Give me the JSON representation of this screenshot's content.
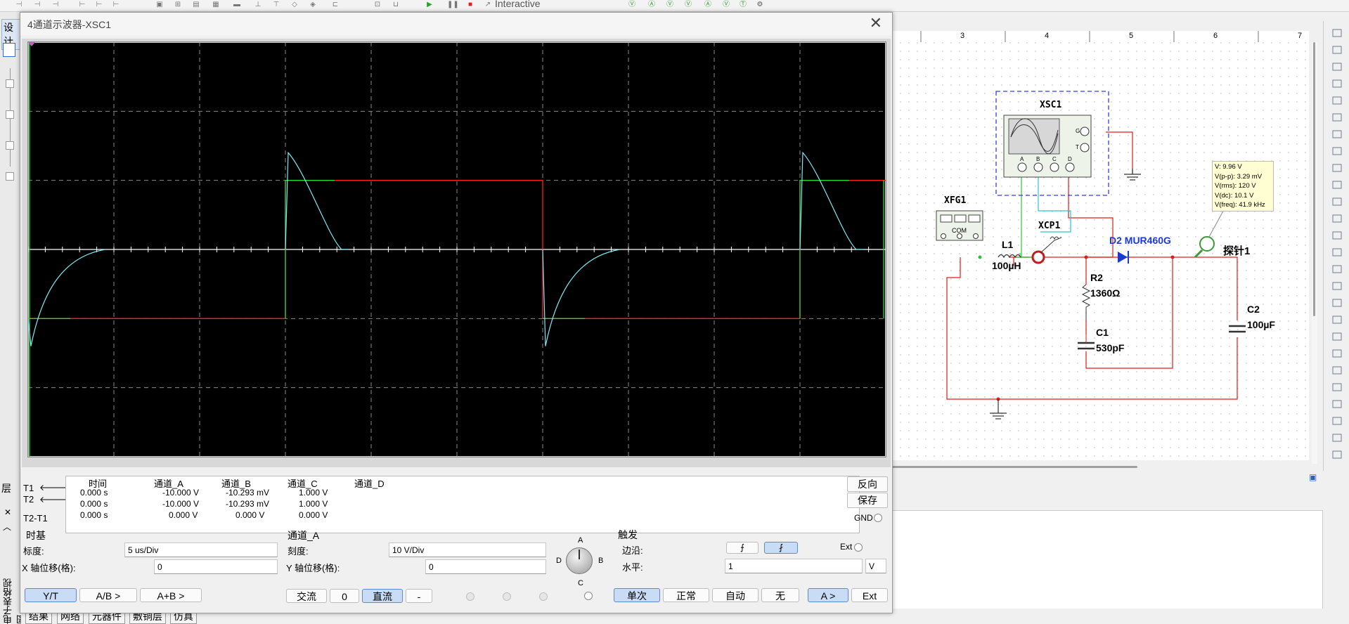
{
  "toolbar": {
    "run_label": "Interactive"
  },
  "left_strip": {
    "tab_label": "设计",
    "vertical_label": "电子表格视图",
    "layer_label": "层",
    "close_label": "✕"
  },
  "scope": {
    "title": "4通道示波器-XSC1",
    "trace_colors": {
      "A": "#ff2020",
      "B": "#2bd63a",
      "C": "#7fe9f5",
      "D": "#ffffff"
    },
    "readout": {
      "headers": [
        "时间",
        "通道_A",
        "通道_B",
        "通道_C",
        "通道_D"
      ],
      "rows": [
        {
          "label": "T1",
          "time": "0.000 s",
          "a": "-10.000 V",
          "b": "-10.293 mV",
          "c": "1.000 V",
          "d": ""
        },
        {
          "label": "T2",
          "time": "0.000 s",
          "a": "-10.000 V",
          "b": "-10.293 mV",
          "c": "1.000 V",
          "d": ""
        },
        {
          "label": "T2-T1",
          "time": "0.000 s",
          "a": "0.000 V",
          "b": "0.000 V",
          "c": "0.000 V",
          "d": ""
        }
      ],
      "reverse_button": "反向",
      "save_button": "保存",
      "gnd_label": "GND"
    },
    "timebase": {
      "title": "时基",
      "scale_label": "标度:",
      "scale_value": "5 us/Div",
      "xpos_label": "X 轴位移(格):",
      "xpos_value": "0",
      "modes": [
        "Y/T",
        "A/B >",
        "A+B >"
      ],
      "selected_mode": "Y/T"
    },
    "channel": {
      "title": "通道_A",
      "scale_label": "刻度:",
      "scale_value": "10  V/Div",
      "ypos_label": "Y 轴位移(格):",
      "ypos_value": "0",
      "knob_labels": {
        "a": "A",
        "b": "B",
        "c": "C",
        "d": "D"
      },
      "coupling": [
        "交流",
        "0",
        "直流",
        "-"
      ],
      "selected_coupling": "直流"
    },
    "trigger": {
      "title": "触发",
      "edge_label": "边沿:",
      "ext_label": "Ext",
      "level_label": "水平:",
      "level_value": "1",
      "level_unit": "V",
      "modes": [
        "单次",
        "正常",
        "自动",
        "无"
      ],
      "selected_mode": "单次",
      "source_button": "A >",
      "ext_button": "Ext"
    }
  },
  "schematic": {
    "ruler_ticks": [
      "3",
      "4",
      "5",
      "6",
      "7"
    ],
    "components": {
      "xsc1": "XSC1",
      "xfg1": "XFG1",
      "xcp1": "XCP1",
      "l1_name": "L1",
      "l1_value": "100µH",
      "d2": "D2 MUR460G",
      "r2_name": "R2",
      "r2_value": "1360Ω",
      "c1_name": "C1",
      "c1_value": "530pF",
      "c2_name": "C2",
      "c2_value": "100µF",
      "probe": "探针1",
      "xfg_com": "COM",
      "scope_terminals": [
        "A",
        "B",
        "C",
        "D"
      ],
      "scope_gt": [
        "G",
        "T"
      ]
    },
    "probe_readout": [
      "V: 9.96 V",
      "V(p-p): 3.29 mV",
      "V(rms): 120 V",
      "V(dc): 10.1 V",
      "V(freq): 41.9 kHz"
    ]
  },
  "bottom_tabs": [
    "结果",
    "网络",
    "元器件",
    "敷铜层",
    "仿真"
  ]
}
